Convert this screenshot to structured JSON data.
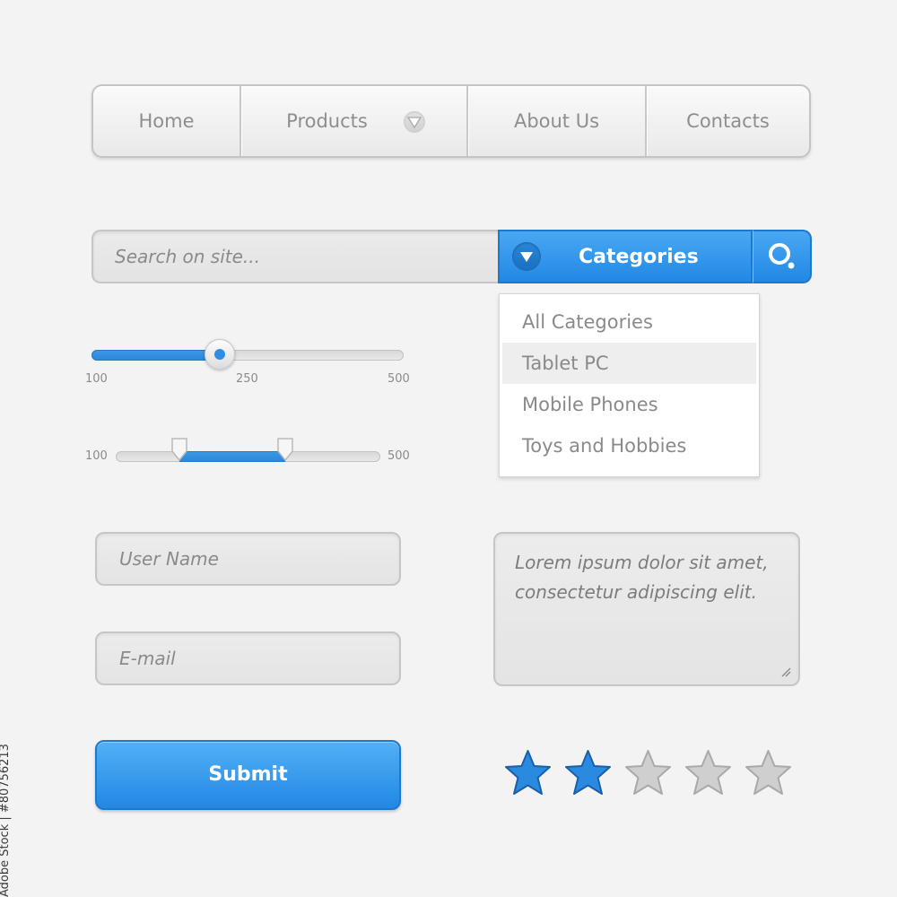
{
  "nav": {
    "items": [
      {
        "label": "Home"
      },
      {
        "label": "Products"
      },
      {
        "label": "About Us"
      },
      {
        "label": "Contacts"
      }
    ]
  },
  "search": {
    "placeholder": "Search on site...",
    "categories_label": "Categories"
  },
  "dropdown": {
    "items": [
      "All Categories",
      "Tablet PC",
      "Mobile Phones",
      "Toys and Hobbies"
    ],
    "highlighted": "Tablet PC"
  },
  "slider_single": {
    "min": "100",
    "mid": "250",
    "max": "500",
    "value_fraction": 0.41
  },
  "slider_range": {
    "min": "100",
    "max": "500",
    "low_fraction": 0.24,
    "high_fraction": 0.64
  },
  "form": {
    "username_placeholder": "User Name",
    "email_placeholder": "E-mail",
    "textarea_text": "Lorem ipsum dolor sit amet, consectetur adipiscing elit.",
    "submit_label": "Submit"
  },
  "rating": {
    "value": 2,
    "max": 5
  },
  "colors": {
    "accent": "#2f8ee2",
    "star_on": "#2a8ae0",
    "star_off": "#cfcfcf"
  },
  "watermark": {
    "stock_id": "Adobe Stock | #80756213"
  }
}
